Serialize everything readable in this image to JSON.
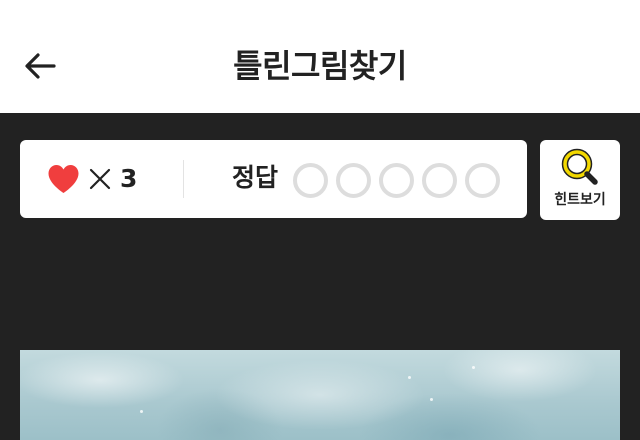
{
  "header": {
    "title": "틀린그림찾기",
    "back_icon": "arrow-left-icon"
  },
  "status": {
    "heart_icon": "heart-icon",
    "heart_color": "#f03e3e",
    "times_symbol": "×",
    "lives": "3",
    "answer_label": "정답",
    "answers_found": 0,
    "answers_total": 5
  },
  "hint": {
    "label": "힌트보기",
    "icon": "magnifier-icon",
    "icon_color": "#f2d800"
  },
  "colors": {
    "background": "#222222",
    "card": "#ffffff",
    "circle_empty": "#dddddd"
  }
}
